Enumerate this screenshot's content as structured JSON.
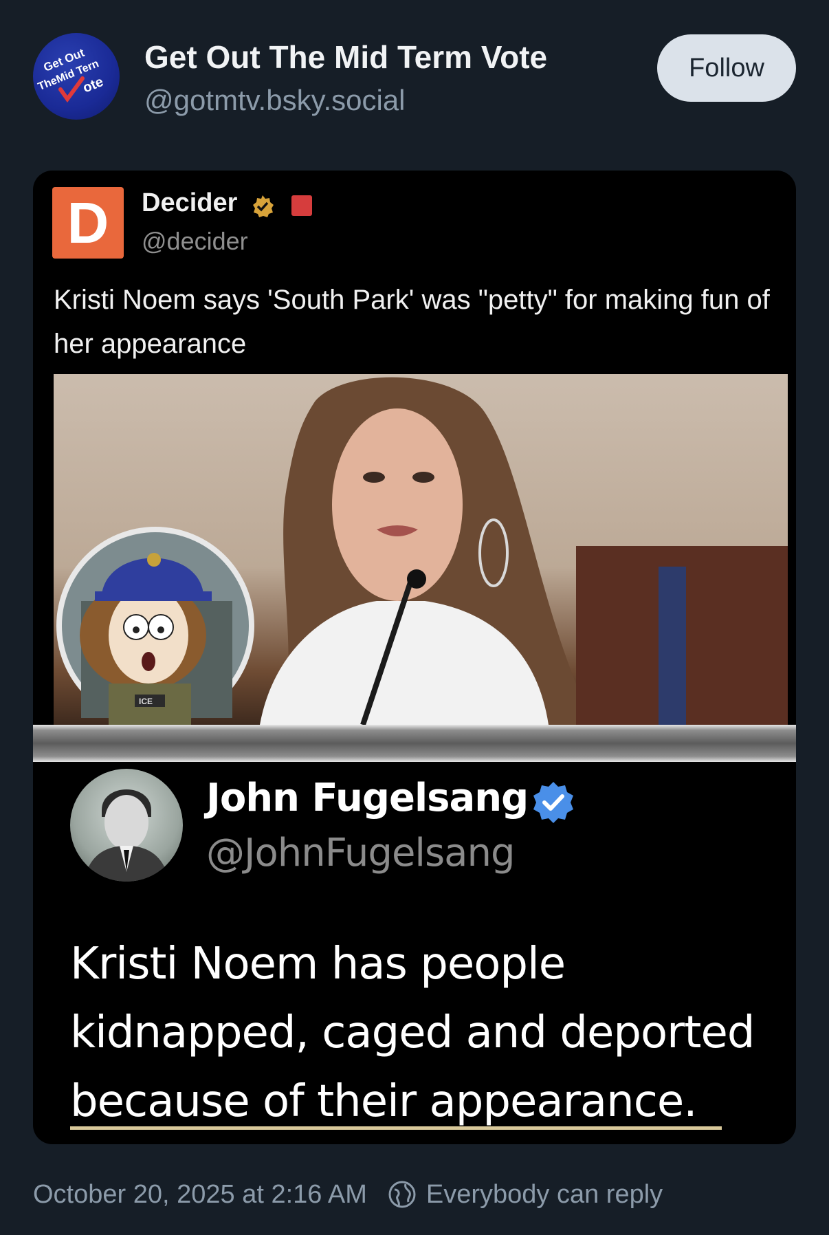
{
  "post": {
    "author": {
      "display_name": "Get Out The Mid Term Vote",
      "handle": "@gotmtv.bsky.social",
      "avatar_text": [
        "Get Out",
        "TheMid Tern",
        "ote"
      ],
      "avatar_icon": "checkmark-icon"
    },
    "follow_label": "Follow",
    "timestamp": "October 20, 2025 at 2:16 AM",
    "reply_setting": "Everybody can reply",
    "reply_icon": "globe-icon"
  },
  "media": {
    "top_tweet": {
      "logo_letter": "D",
      "name": "Decider",
      "handle": "@decider",
      "text": "Kristi Noem says 'South Park' was \"petty\" for making fun of her appearance",
      "badge_icon": "verified-badge-icon"
    },
    "bottom_tweet": {
      "name": "John Fugelsang",
      "handle": "@JohnFugelsang",
      "text": "Kristi Noem has people kidnapped, caged and deported because of their appearance.",
      "badge_icon": "verified-badge-icon"
    },
    "cartoon_badge_text": "ICE"
  },
  "colors": {
    "background": "#161e27",
    "follow_button": "#dbe2ea",
    "muted_text": "#8c9baa",
    "verified_blue": "#4a8fe8",
    "decider_orange": "#e9683c",
    "decider_gold_badge": "#d8a33a"
  }
}
